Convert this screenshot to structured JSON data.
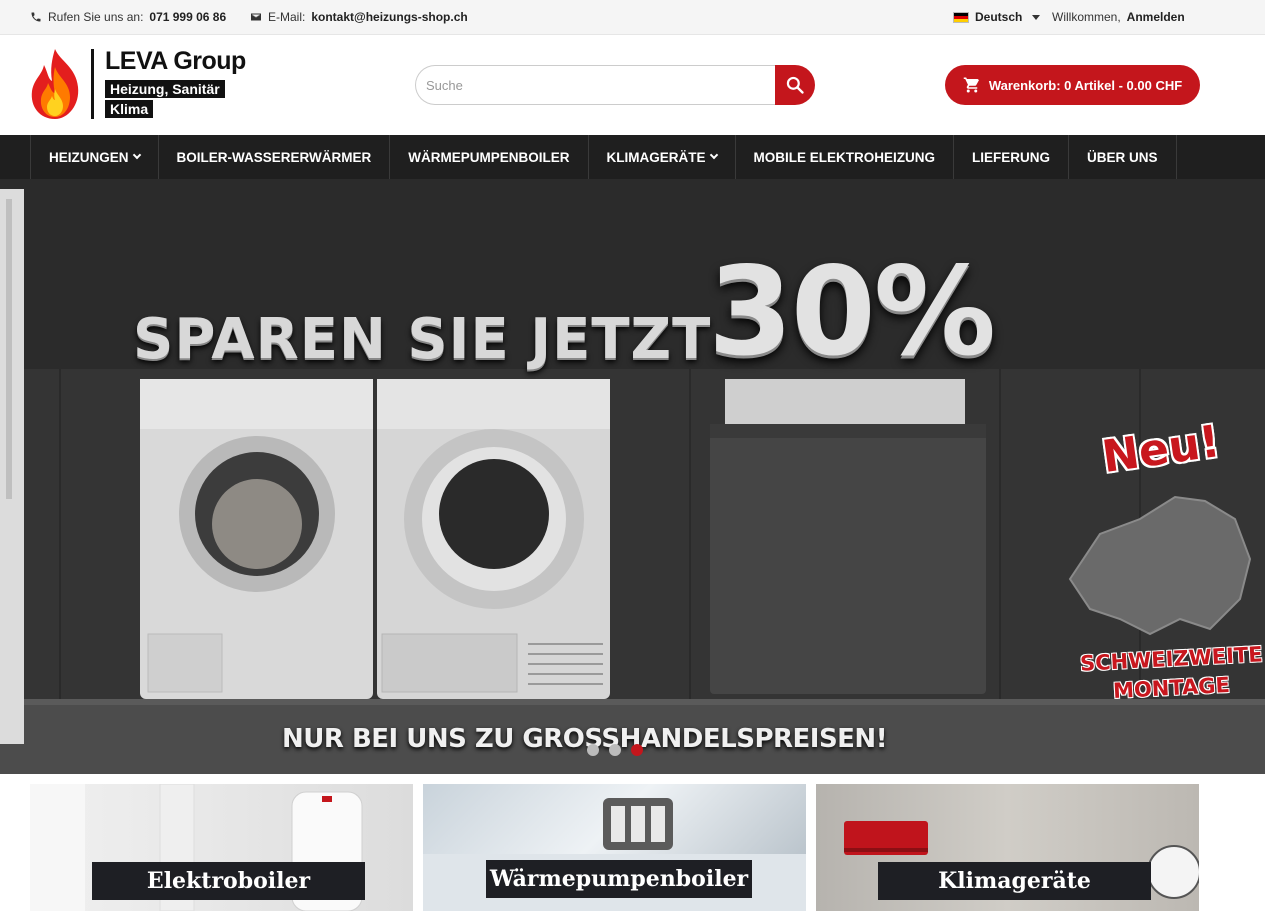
{
  "topbar": {
    "phone_prefix": "Rufen Sie uns an:",
    "phone_number": "071 999 06 86",
    "email_prefix": "E-Mail:",
    "email_address": "kontakt@heizungs-shop.ch",
    "language": "Deutsch",
    "welcome": "Willkommen,",
    "login": "Anmelden"
  },
  "logo": {
    "title": "LEVA Group",
    "line1": "Heizung, Sanitär",
    "line2": "Klima"
  },
  "search": {
    "placeholder": "Suche",
    "value": ""
  },
  "cart": {
    "label": "Warenkorb: 0 Artikel - 0.00 CHF"
  },
  "nav": {
    "items": [
      {
        "label": "HEIZUNGEN",
        "has_dropdown": true
      },
      {
        "label": "BOILER-WASSERERWÄRMER",
        "has_dropdown": false
      },
      {
        "label": "WÄRMEPUMPENBOILER",
        "has_dropdown": false
      },
      {
        "label": "KLIMAGERÄTE",
        "has_dropdown": true
      },
      {
        "label": "MOBILE ELEKTROHEIZUNG",
        "has_dropdown": false
      },
      {
        "label": "LIEFERUNG",
        "has_dropdown": false
      },
      {
        "label": "ÜBER UNS",
        "has_dropdown": false
      }
    ]
  },
  "hero": {
    "headline": "SPAREN SIE JETZT",
    "percent": "30%",
    "footer": "NUR BEI UNS ZU GROSSHANDELSPREISEN!",
    "badge_new": "Neu!",
    "badge_line1": "SCHWEIZWEITE",
    "badge_line2": "MONTAGE",
    "slides": 3,
    "active_slide": 3
  },
  "tiles": [
    {
      "label": "Elektroboiler"
    },
    {
      "label": "Wärmepumpenboiler"
    },
    {
      "label": "Klimageräte"
    }
  ],
  "colors": {
    "accent": "#c4161c",
    "nav_bg": "#1f1f1f",
    "topbar_bg": "#f5f5f5"
  }
}
